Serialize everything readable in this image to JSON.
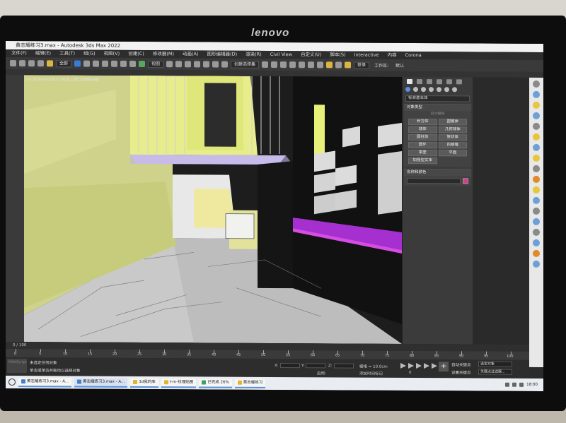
{
  "monitor": {
    "brand": "lenovo"
  },
  "titlebar": {
    "title": "黄志耀练习3.max - Autodesk 3ds Max 2022"
  },
  "menu": [
    "文件(F)",
    "编辑(E)",
    "工具(T)",
    "组(G)",
    "视图(V)",
    "创建(C)",
    "修改器(M)",
    "动画(A)",
    "图形编辑器(D)",
    "渲染(R)",
    "Civil View",
    "自定义(U)",
    "脚本(S)",
    "Interactive",
    "内容",
    "Corona"
  ],
  "toolbar": {
    "select_all": "全部",
    "view": "视图",
    "named_selection": "创建选择集",
    "search": "登录",
    "workspace_label": "工作区:",
    "workspace_value": "默认"
  },
  "viewport": {
    "label": "[+] [Camera001] [标准] [默认明暗处理]"
  },
  "command_panel": {
    "category_dropdown": "标准基本体",
    "rollout_object_type": "对象类型",
    "autogrid": "自动栅格",
    "buttons": [
      "长方体",
      "圆锥体",
      "球体",
      "几何球体",
      "圆柱体",
      "管状体",
      "圆环",
      "四棱锥",
      "茶壶",
      "平面",
      "加强型文本"
    ],
    "rollout_name_color": "名称和颜色",
    "color": "#d93a8c"
  },
  "timeline": {
    "frame": "0 / 100",
    "ticks": [
      "0",
      "5",
      "10",
      "15",
      "20",
      "25",
      "30",
      "35",
      "40",
      "45",
      "50",
      "55",
      "60",
      "65",
      "70",
      "75",
      "80",
      "85",
      "90",
      "95",
      "100"
    ]
  },
  "status": {
    "script_box": "MAXScript",
    "selection": "未选定任何对象",
    "hint": "单击或单击并拖动以选择对象",
    "x_label": "X:",
    "y_label": "Y:",
    "z_label": "Z:",
    "grid": "栅格 = 10.0cm",
    "enable": "启用:",
    "add_time_tag": "添加时间标记",
    "auto_key": "自动关键点",
    "selected_object": "选定对象",
    "set_key": "设置关键点",
    "key_filters": "关键点过滤器...",
    "time_value": "0"
  },
  "taskbar": {
    "items": [
      "黄志耀练习3.max - A...",
      "黄志耀练习3.max - A...",
      "3d我的库",
      "t-m-纹理贴图",
      "已完成 26%",
      "黄志耀练习"
    ],
    "time": "18:00"
  }
}
